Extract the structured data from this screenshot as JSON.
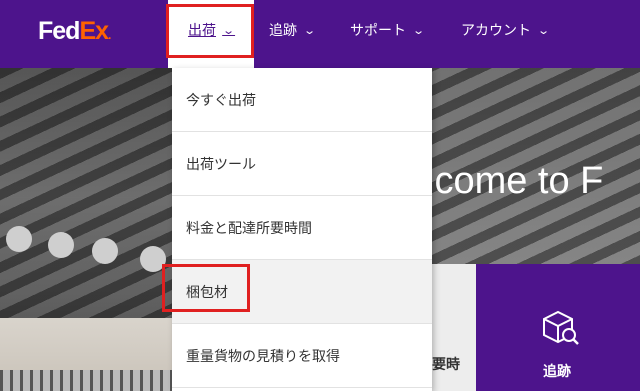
{
  "brand": {
    "part1": "Fed",
    "part2": "Ex",
    "mark": "."
  },
  "nav": {
    "items": [
      {
        "label": "出荷",
        "chevron": "chevron-down-icon"
      },
      {
        "label": "追跡",
        "chevron": "chevron-down-icon"
      },
      {
        "label": "サポート",
        "chevron": "chevron-down-icon"
      },
      {
        "label": "アカウント",
        "chevron": "chevron-down-icon"
      }
    ]
  },
  "dropdown": {
    "items": [
      {
        "label": "今すぐ出荷"
      },
      {
        "label": "出荷ツール"
      },
      {
        "label": "料金と配達所要時間"
      },
      {
        "label": "梱包材"
      },
      {
        "label": "重量貨物の見積りを取得"
      }
    ]
  },
  "hero": {
    "headline": "lcome to F"
  },
  "cards": {
    "partial_label": "要時",
    "track_label": "追跡",
    "track_icon": "package-search-icon"
  },
  "colors": {
    "brand_purple": "#4d148c",
    "brand_orange": "#ff6200",
    "highlight_red": "#e02020"
  }
}
